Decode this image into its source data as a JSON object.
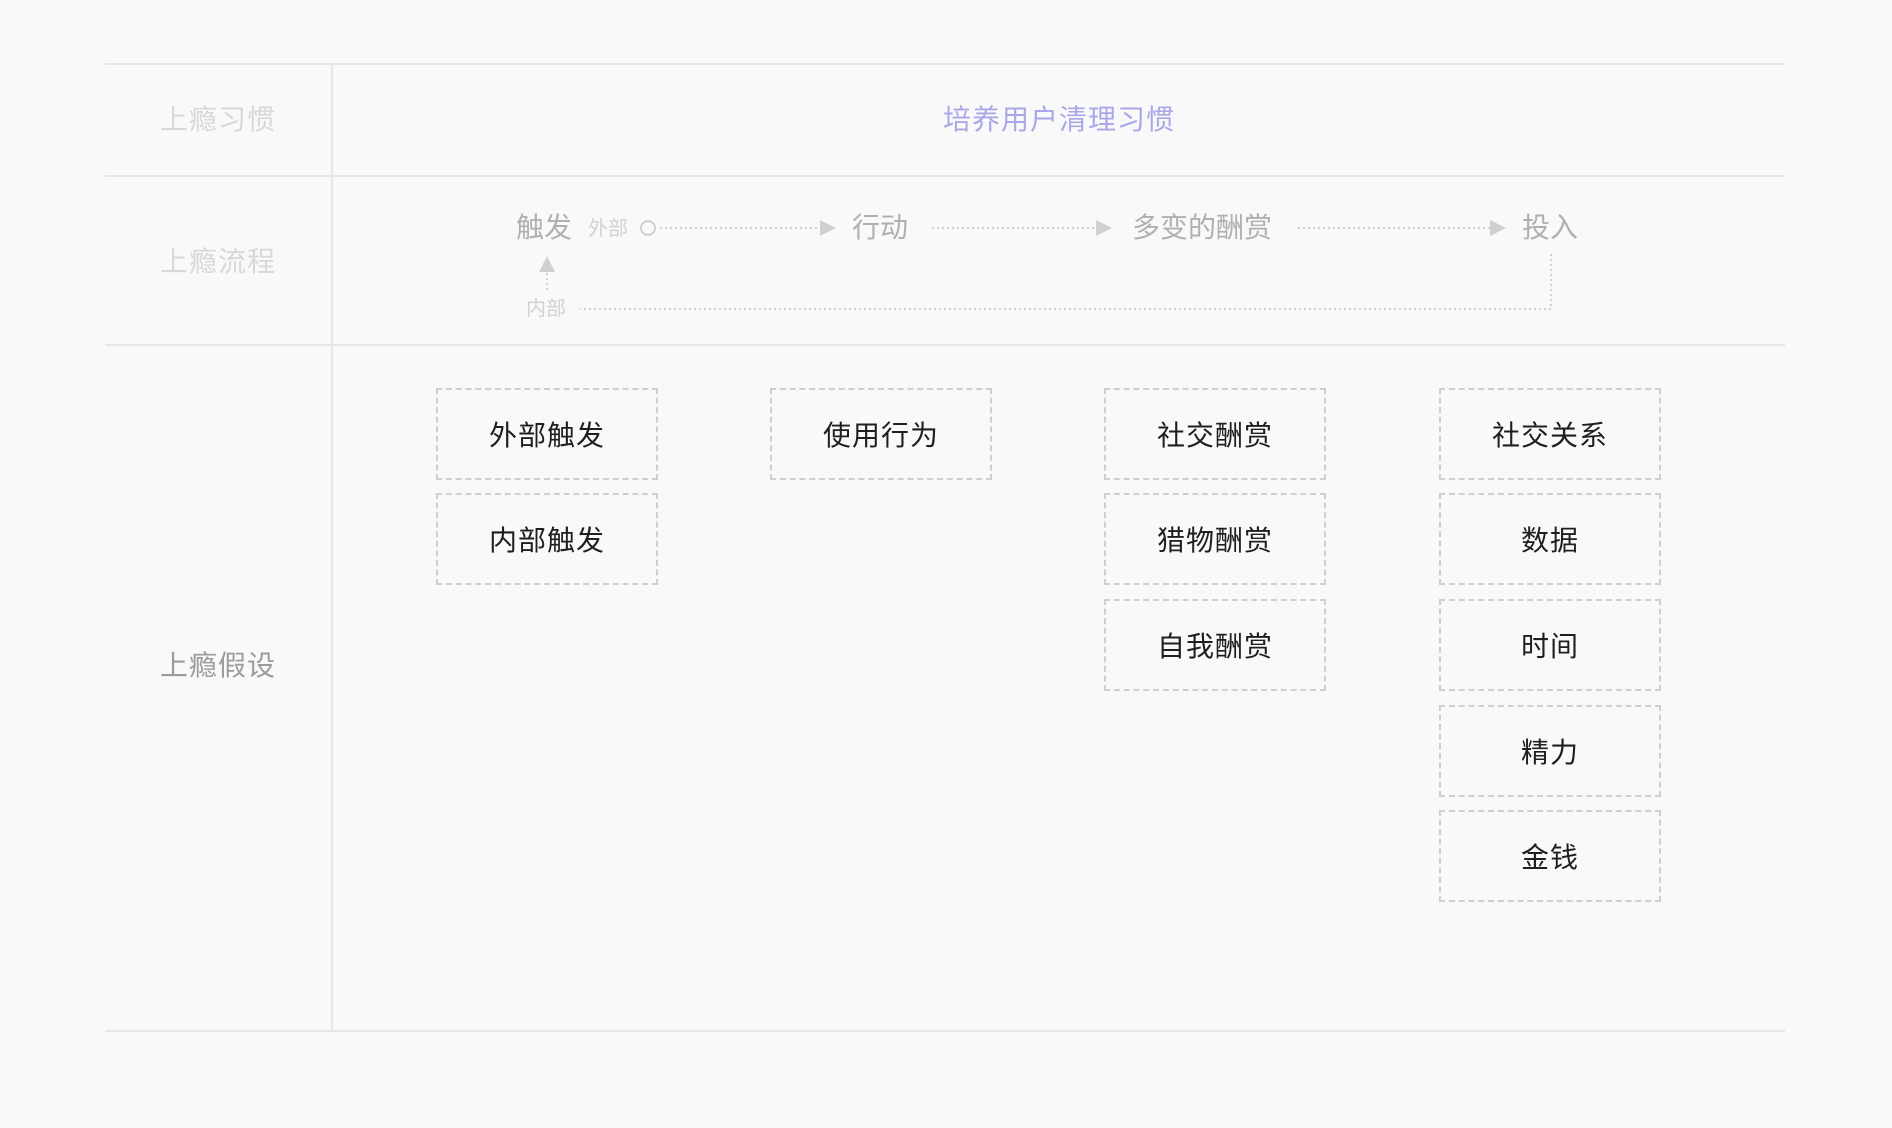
{
  "rows": {
    "habit_label": "上瘾习惯",
    "flow_label": "上瘾流程",
    "hypothesis_label": "上瘾假设"
  },
  "habit_title": "培养用户清理习惯",
  "colors": {
    "accent": "#a9a7e8",
    "grid": "#e6e6e6",
    "flow": "#d0d0d0"
  },
  "flow": {
    "trigger": "触发",
    "external": "外部",
    "internal": "内部",
    "action": "行动",
    "reward": "多变的酬赏",
    "investment": "投入"
  },
  "hypotheses": {
    "trigger": [
      "外部触发",
      "内部触发"
    ],
    "action": [
      "使用行为"
    ],
    "reward": [
      "社交酬赏",
      "猎物酬赏",
      "自我酬赏"
    ],
    "investment": [
      "社交关系",
      "数据",
      "时间",
      "精力",
      "金钱"
    ]
  }
}
